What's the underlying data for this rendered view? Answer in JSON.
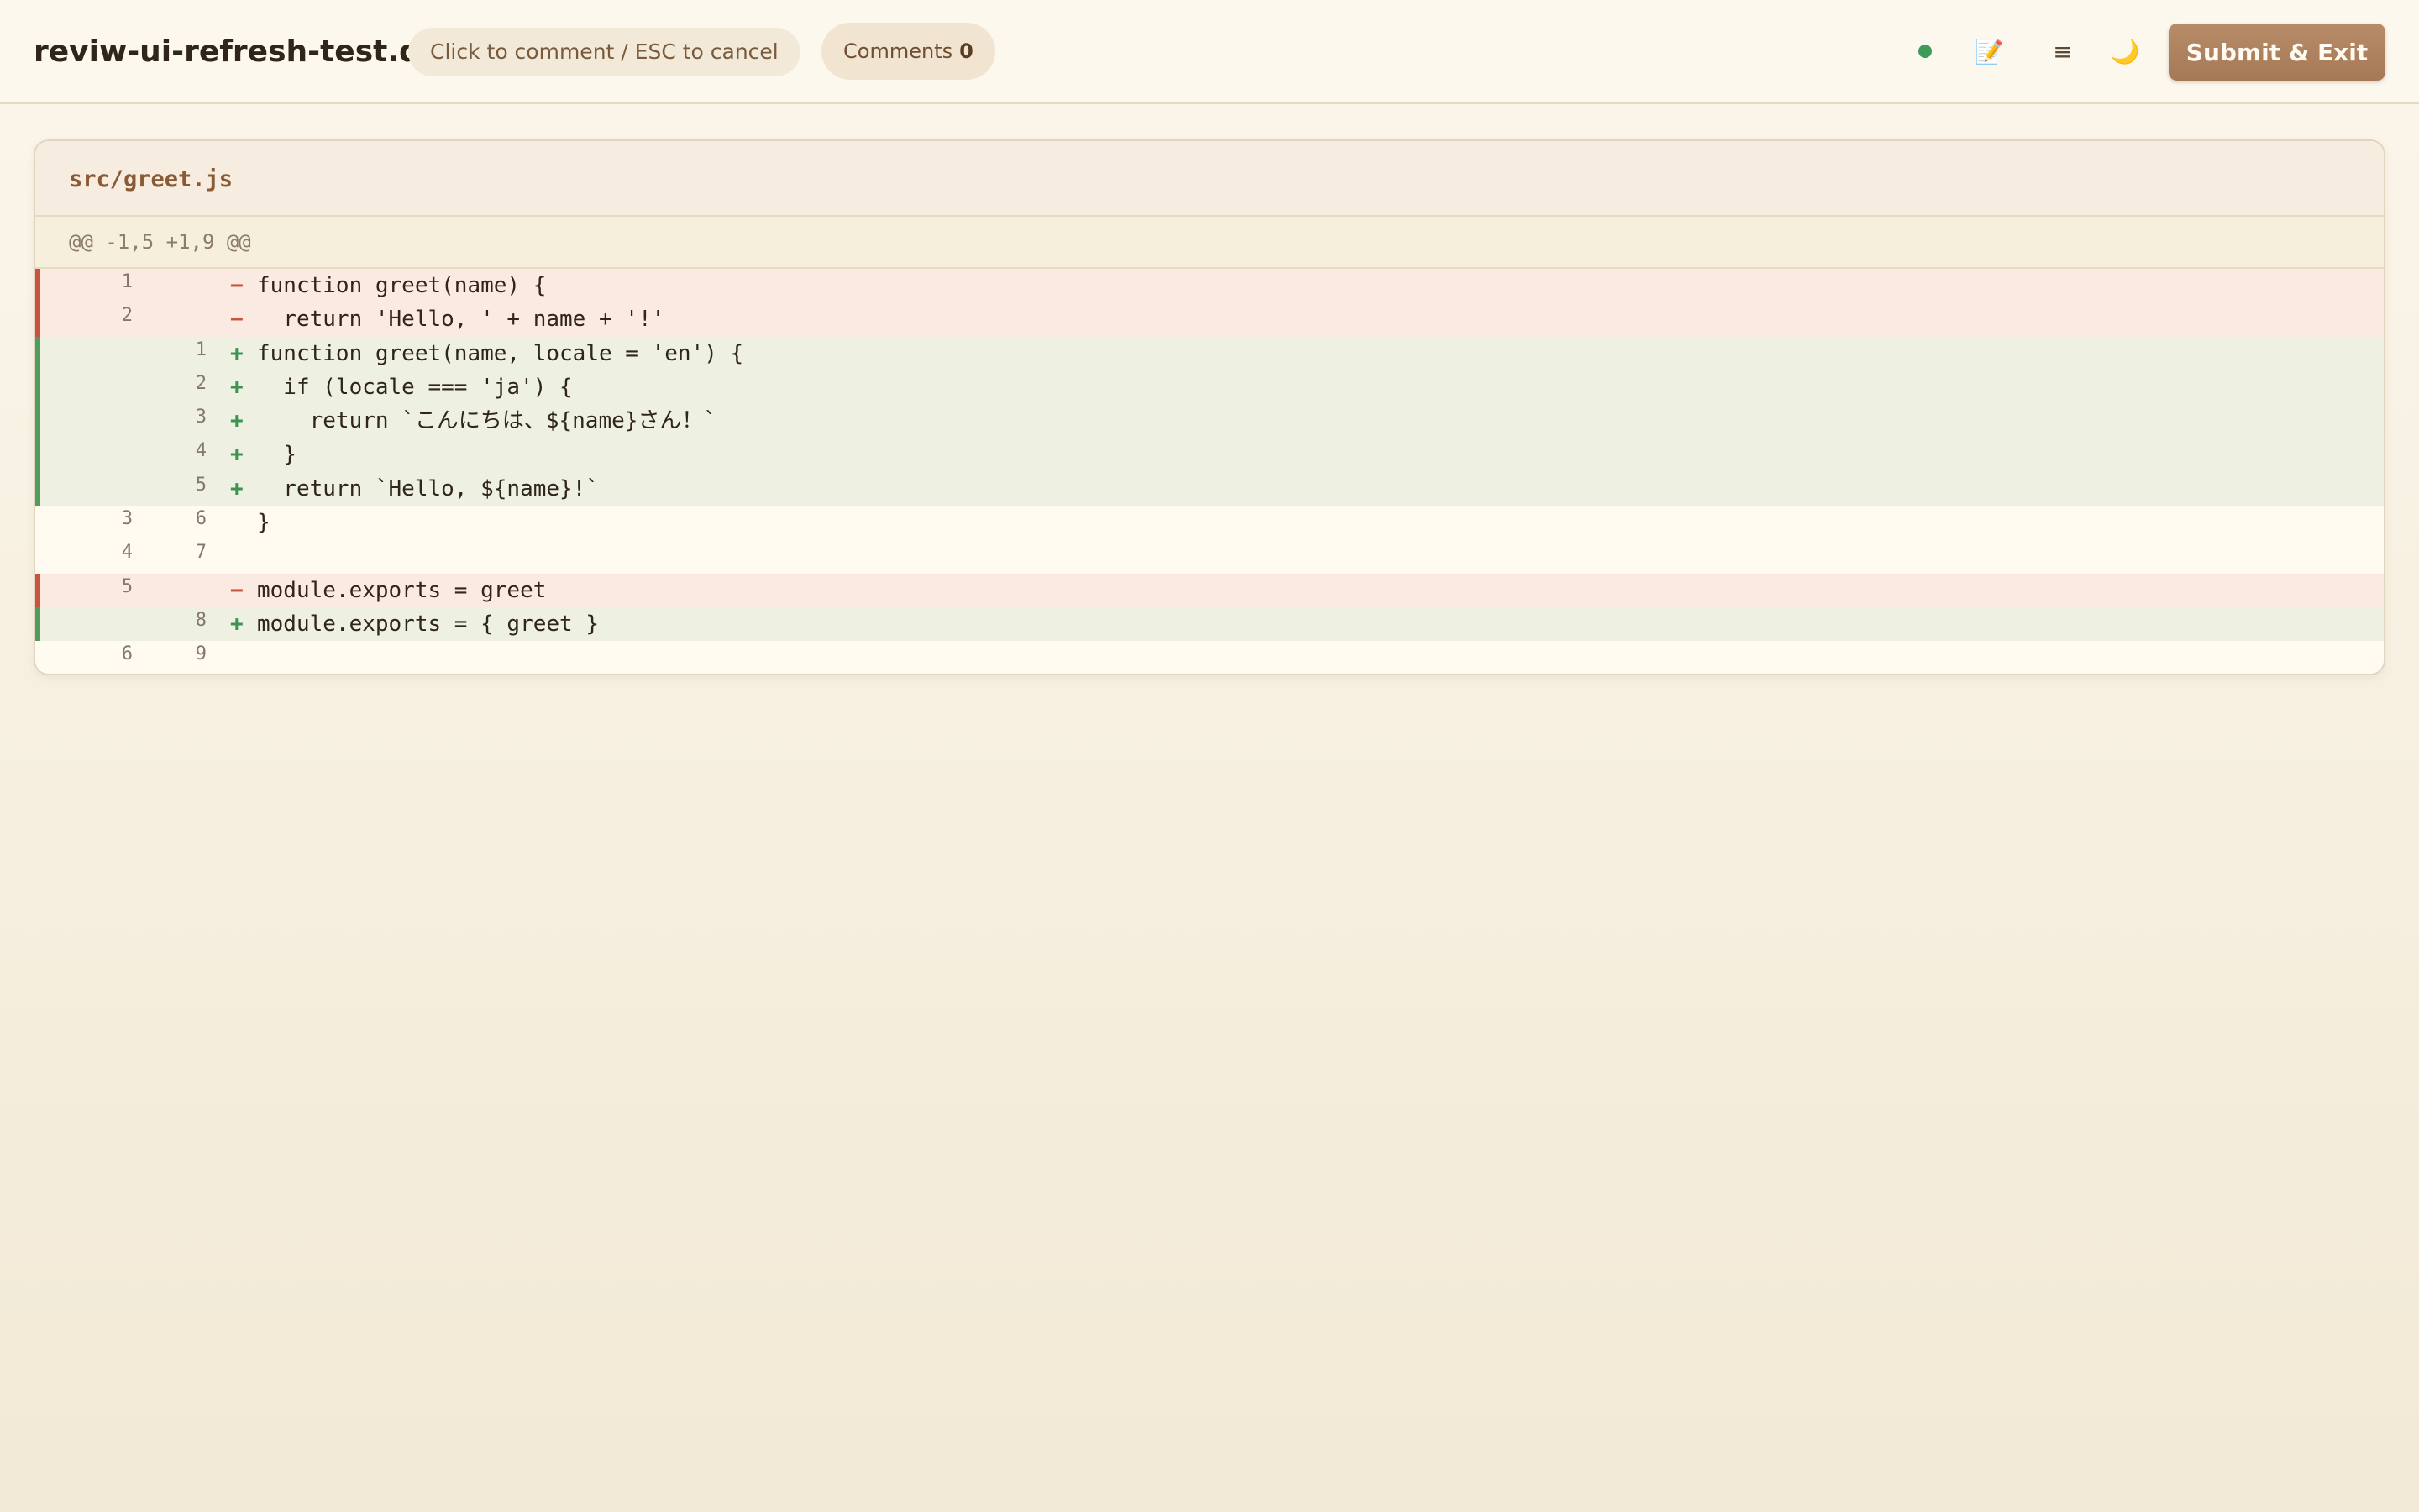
{
  "header": {
    "title": "reviw-ui-refresh-test.diff",
    "hint": "Click to comment / ESC to cancel",
    "comments_label": "Comments",
    "comments_count": "0",
    "icons": [
      "status-dot",
      "memo-icon",
      "menu-icon",
      "moon-icon"
    ],
    "submit_label": "Submit & Exit"
  },
  "file": {
    "name": "src/greet.js",
    "hunk": "@@ -1,5 +1,9 @@",
    "lines": [
      {
        "type": "del",
        "old": "1",
        "new": "",
        "marker": "−",
        "code": "function greet(name) {"
      },
      {
        "type": "del",
        "old": "2",
        "new": "",
        "marker": "−",
        "code": "  return 'Hello, ' + name + '!'"
      },
      {
        "type": "add",
        "old": "",
        "new": "1",
        "marker": "+",
        "code": "function greet(name, locale = 'en') {"
      },
      {
        "type": "add",
        "old": "",
        "new": "2",
        "marker": "+",
        "code": "  if (locale === 'ja') {"
      },
      {
        "type": "add",
        "old": "",
        "new": "3",
        "marker": "+",
        "code": "    return `こんにちは、${name}さん！`"
      },
      {
        "type": "add",
        "old": "",
        "new": "4",
        "marker": "+",
        "code": "  }"
      },
      {
        "type": "add",
        "old": "",
        "new": "5",
        "marker": "+",
        "code": "  return `Hello, ${name}!`"
      },
      {
        "type": "ctx",
        "old": "3",
        "new": "6",
        "marker": "",
        "code": "}"
      },
      {
        "type": "ctx",
        "old": "4",
        "new": "7",
        "marker": "",
        "code": ""
      },
      {
        "type": "del",
        "old": "5",
        "new": "",
        "marker": "−",
        "code": "module.exports = greet"
      },
      {
        "type": "add",
        "old": "",
        "new": "8",
        "marker": "+",
        "code": "module.exports = { greet }"
      },
      {
        "type": "ctx",
        "old": "6",
        "new": "9",
        "marker": "",
        "code": ""
      }
    ]
  },
  "colors": {
    "accent": "#a67956",
    "deleted": "#c9533f",
    "added": "#4f9c5c",
    "status_online": "#3e9b5a"
  }
}
